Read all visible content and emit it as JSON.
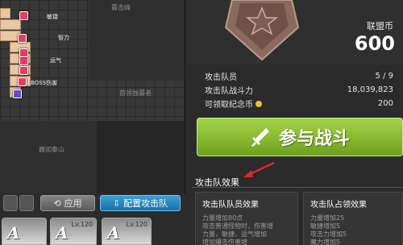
{
  "map": {
    "labels": {
      "top_center": "暮击峰",
      "mid_right": "首领独暮者",
      "bottom": "巍如泰山"
    },
    "slots": [
      {
        "label": "敏捷",
        "kind": "red"
      },
      {
        "label": "智力",
        "kind": "red"
      },
      {
        "label": "运气",
        "kind": "red"
      },
      {
        "label": "",
        "kind": "red"
      },
      {
        "label": "BOSS伤害",
        "kind": "red"
      },
      {
        "label": "",
        "kind": "red"
      },
      {
        "label": "",
        "kind": "purple"
      }
    ]
  },
  "controls": {
    "apply_label": "应用",
    "config_label": "配置攻击队"
  },
  "cards": [
    {
      "letter": "A",
      "level": ""
    },
    {
      "letter": "A",
      "level": "Lv.120"
    },
    {
      "letter": "A",
      "level": "Lv.120"
    }
  ],
  "currency": {
    "label": "联盟币",
    "value": "600"
  },
  "stats": {
    "members_label": "攻击队员",
    "members_value": "5 / 9",
    "power_label": "攻击队战斗力",
    "power_value": "18,039,823",
    "claimable_label": "可领取纪念币",
    "claimable_value": "200"
  },
  "battle": {
    "label": "参与战斗"
  },
  "effects": {
    "title": "攻击队效果",
    "member_effects": {
      "title": "攻击队队员效果",
      "lines": [
        "力量增加80点",
        "攻击普通怪物时，伤害增",
        "力量，敏捷，运气增加",
        "增加爆击伤害增"
      ]
    },
    "occupy_effects": {
      "title": "攻击队占领效果",
      "lines": [
        "力量增加25",
        "敏捷增加5",
        "攻击力增加5",
        "魔力增加5"
      ]
    }
  },
  "colors": {
    "accent_green": "#8bc034",
    "accent_blue": "#2a8cc6",
    "slot_red": "#e33f63",
    "slot_purple": "#6a4cc8",
    "tile_beige": "#e8c7a4",
    "arrow_red": "#e0252a"
  }
}
